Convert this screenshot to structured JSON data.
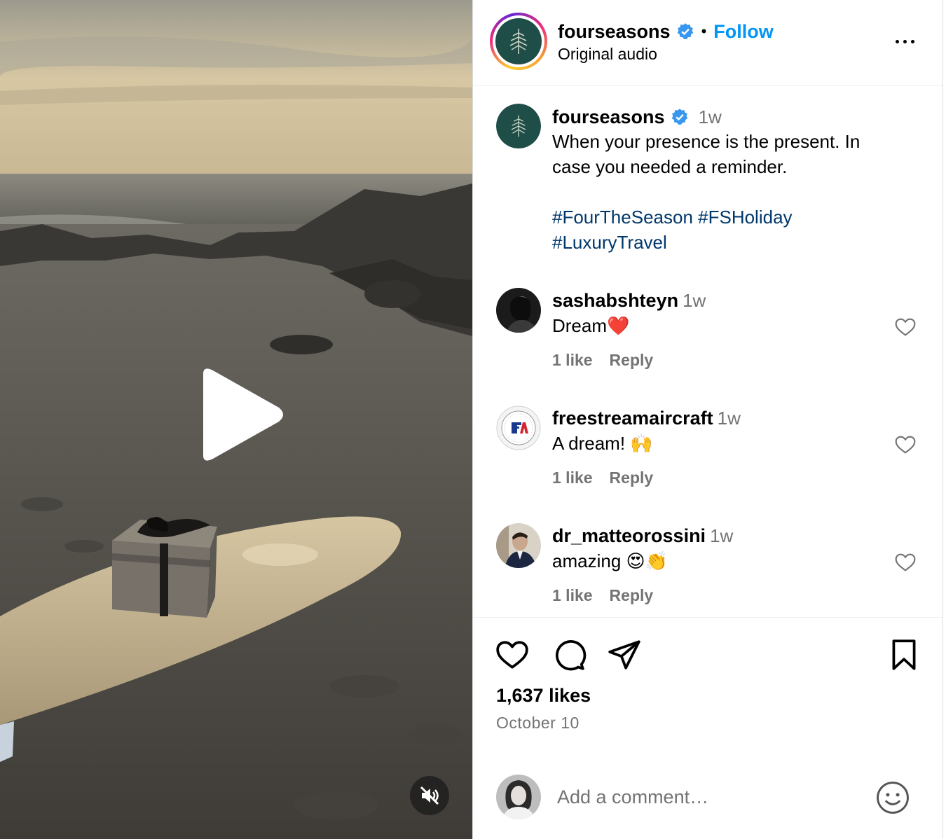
{
  "post": {
    "account": {
      "username": "fourseasons",
      "verified": true,
      "follow_label": "Follow",
      "separator": "•",
      "audio": "Original audio"
    },
    "caption": {
      "username": "fourseasons",
      "time": "1w",
      "text": "When your presence is the present. In case you needed a reminder.",
      "hashtags": [
        "#FourTheSeason",
        "#FSHoliday",
        "#LuxuryTravel"
      ]
    },
    "comments": [
      {
        "username": "sashabshteyn",
        "time": "1w",
        "text": "Dream❤️",
        "likes": "1 like",
        "reply": "Reply"
      },
      {
        "username": "freestreamaircraft",
        "time": "1w",
        "text": "A dream! 🙌",
        "likes": "1 like",
        "reply": "Reply"
      },
      {
        "username": "dr_matteorossini",
        "time": "1w",
        "text": "amazing 😍👏",
        "likes": "1 like",
        "reply": "Reply"
      }
    ],
    "likes_count": "1,637 likes",
    "date": "October 10",
    "add_comment_placeholder": "Add a comment…"
  },
  "colors": {
    "link_blue": "#0095f6",
    "hashtag_blue": "#00376b",
    "secondary_text": "#737373",
    "brand_green": "#1f4d47"
  },
  "icons": [
    "play-icon",
    "mute-icon",
    "verified-icon",
    "more-icon",
    "heart-icon",
    "comment-icon",
    "share-icon",
    "bookmark-icon",
    "emoji-icon"
  ]
}
